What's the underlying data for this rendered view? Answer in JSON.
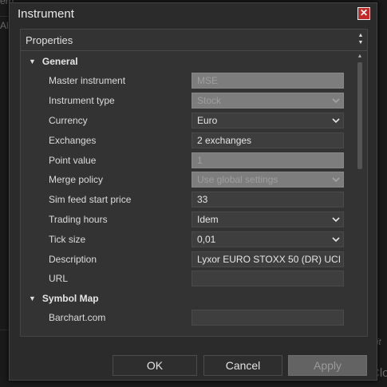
{
  "background": {
    "frag_top": "ern",
    "frag_all": "All",
    "frag_edit": "dit",
    "frag_clo": "Clo"
  },
  "dialog": {
    "title": "Instrument",
    "properties_header": "Properties",
    "sections": [
      {
        "name": "General",
        "rows": [
          {
            "label": "Master instrument",
            "value": "MSE",
            "disabled": true,
            "dropdown": false
          },
          {
            "label": "Instrument type",
            "value": "Stock",
            "disabled": true,
            "dropdown": true
          },
          {
            "label": "Currency",
            "value": "Euro",
            "disabled": false,
            "dropdown": true
          },
          {
            "label": "Exchanges",
            "value": "2 exchanges",
            "disabled": false,
            "dropdown": false
          },
          {
            "label": "Point value",
            "value": "1",
            "disabled": true,
            "dropdown": false
          },
          {
            "label": "Merge policy",
            "value": "Use global settings",
            "disabled": true,
            "dropdown": true
          },
          {
            "label": "Sim feed start price",
            "value": "33",
            "disabled": false,
            "dropdown": false
          },
          {
            "label": "Trading hours",
            "value": "Idem",
            "disabled": false,
            "dropdown": true
          },
          {
            "label": "Tick size",
            "value": "0,01",
            "disabled": false,
            "dropdown": true
          },
          {
            "label": "Description",
            "value": "Lyxor EURO STOXX 50 (DR) UCI",
            "disabled": false,
            "dropdown": false
          },
          {
            "label": "URL",
            "value": "",
            "disabled": false,
            "dropdown": false
          }
        ]
      },
      {
        "name": "Symbol Map",
        "rows": [
          {
            "label": "Barchart.com",
            "value": "",
            "disabled": false,
            "dropdown": false
          }
        ]
      }
    ],
    "buttons": {
      "ok": "OK",
      "cancel": "Cancel",
      "apply": "Apply"
    }
  },
  "icons": {
    "close": "close-icon",
    "collapse": "triangle-down-icon",
    "dropdown": "chevron-down-icon"
  },
  "colors": {
    "close_button": "#c42a2a",
    "dialog_bg": "#2b2b2b",
    "field_bg": "#3e3e3e",
    "disabled_field_bg": "#7d7d7d"
  }
}
